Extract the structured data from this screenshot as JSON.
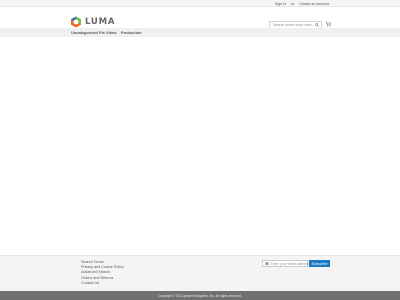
{
  "top_links": {
    "sign_in": "Sign In",
    "separator": "or",
    "create_account": "Create an Account"
  },
  "header": {
    "logo_text": "LUMA",
    "search_placeholder": "Search entire store here...",
    "search_icon": "search-icon",
    "cart_icon": "cart-icon"
  },
  "nav": {
    "items": [
      "Uncategorized",
      "Pie Video",
      "Production"
    ]
  },
  "footer": {
    "links": [
      "Search Terms",
      "Privacy and Cookie Policy",
      "Advanced Search",
      "Orders and Returns",
      "Contact Us"
    ],
    "newsletter_placeholder": "Enter your email address",
    "subscribe_label": "Subscribe",
    "copyright": "Copyright © 2013-present Magento, Inc. All rights reserved."
  },
  "colors": {
    "accent": "#1979c3",
    "logo_orange": "#f26322",
    "logo_green": "#6ebe44",
    "copyright_bg": "#6e716e"
  }
}
